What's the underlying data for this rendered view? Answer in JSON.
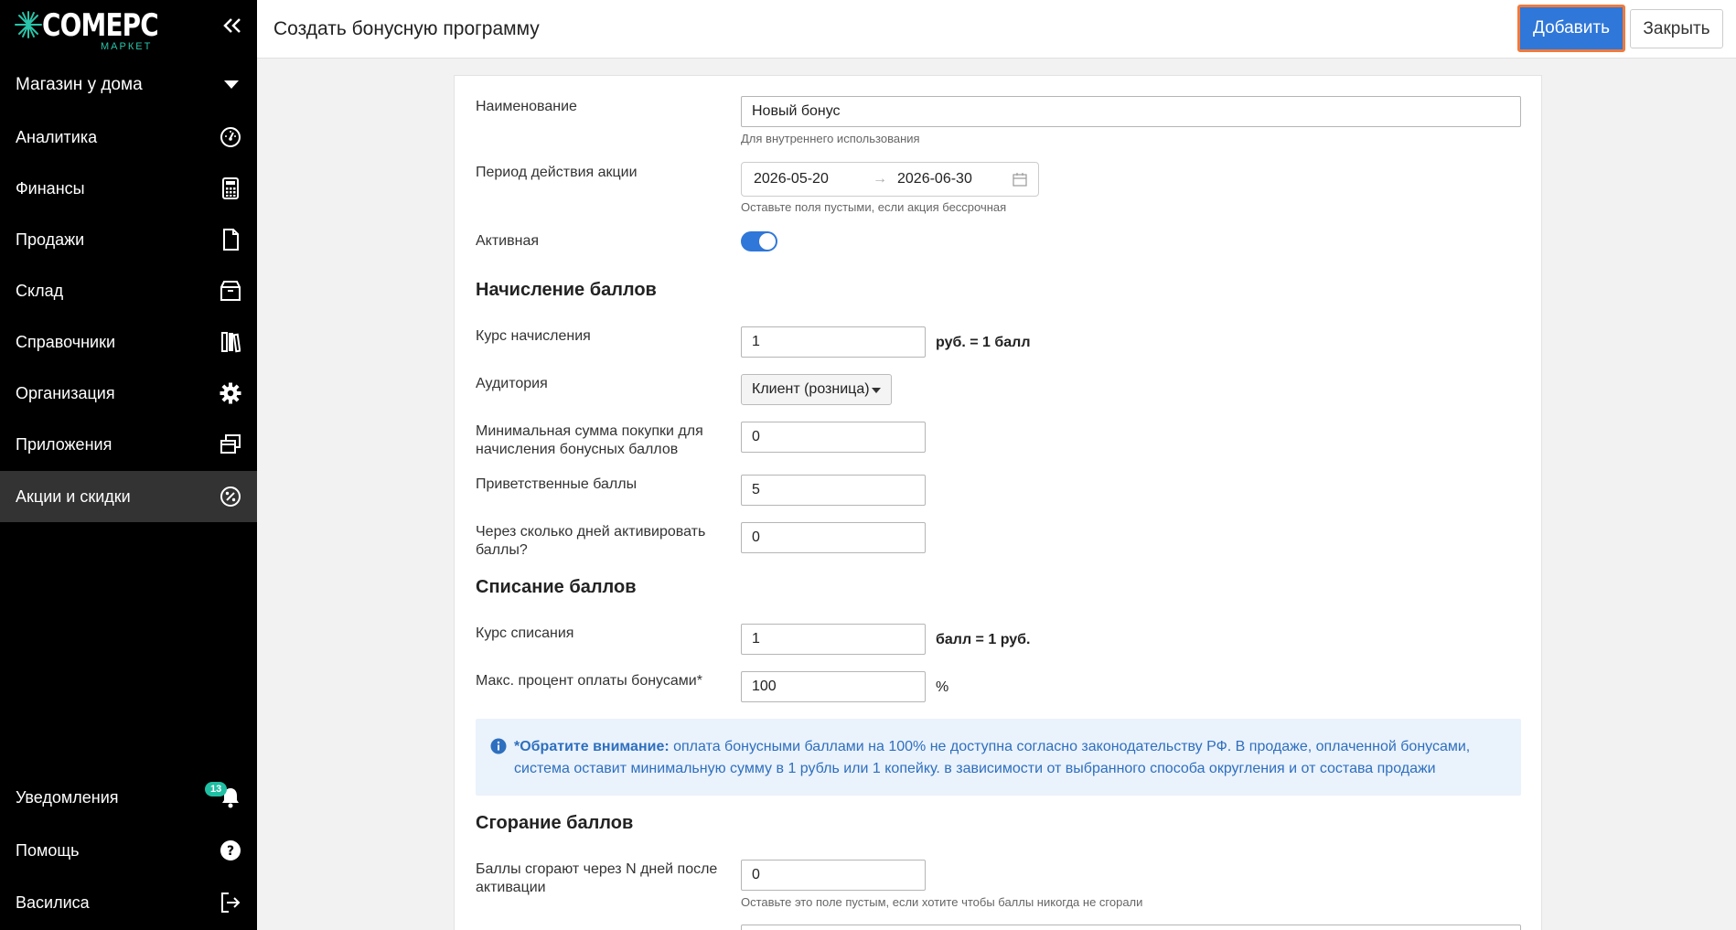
{
  "sidebar": {
    "logo": {
      "name": "COMEPC",
      "sub": "МАРКЕТ"
    },
    "store": "Магазин у дома",
    "items": [
      {
        "label": "Аналитика",
        "icon": "gauge-icon"
      },
      {
        "label": "Финансы",
        "icon": "calculator-icon"
      },
      {
        "label": "Продажи",
        "icon": "document-icon"
      },
      {
        "label": "Склад",
        "icon": "box-icon"
      },
      {
        "label": "Справочники",
        "icon": "books-icon"
      },
      {
        "label": "Организация",
        "icon": "gear-icon"
      },
      {
        "label": "Приложения",
        "icon": "windows-icon"
      },
      {
        "label": "Акции и скидки",
        "icon": "percent-icon"
      }
    ],
    "bottom": [
      {
        "label": "Уведомления",
        "icon": "bell-icon",
        "badge": "13"
      },
      {
        "label": "Помощь",
        "icon": "help-icon"
      },
      {
        "label": "Василиса",
        "icon": "logout-icon"
      }
    ]
  },
  "header": {
    "title": "Создать бонусную программу",
    "add_label": "Добавить",
    "close_label": "Закрыть"
  },
  "form": {
    "name_label": "Наименование",
    "name_value": "Новый бонус",
    "name_help": "Для внутреннего использования",
    "period_label": "Период действия акции",
    "period_start": "2026-05-20",
    "period_end": "2026-06-30",
    "period_help": "Оставьте поля пустыми, если акция бессрочная",
    "active_label": "Активная",
    "accrual_section": "Начисление баллов",
    "accrual_rate_label": "Курс начисления",
    "accrual_rate_value": "1",
    "accrual_rate_suffix": "руб. = 1 балл",
    "audience_label": "Аудитория",
    "audience_value": "Клиент (розница)",
    "min_sum_label": "Минимальная сумма покупки для начисления бонусных баллов",
    "min_sum_value": "0",
    "welcome_label": "Приветственные баллы",
    "welcome_value": "5",
    "activate_days_label": "Через сколько дней активировать баллы?",
    "activate_days_value": "0",
    "writeoff_section": "Списание баллов",
    "writeoff_rate_label": "Курс списания",
    "writeoff_rate_value": "1",
    "writeoff_rate_suffix": "балл = 1 руб.",
    "max_percent_label": "Макс. процент оплаты бонусами*",
    "max_percent_value": "100",
    "max_percent_suffix": "%",
    "notice_bold": "*Обратите внимание:",
    "notice_text": " оплата бонусными баллами на 100% не доступна согласно законодательству РФ. В продаже, оплаченной бонусами, система оставит минимальную сумму в 1 рубль или 1 копейку. в зависимости от выбранного способа округления и от состава продажи",
    "burn_section": "Сгорание баллов",
    "burn_days_label": "Баллы сгорают через N дней после активации",
    "burn_days_value": "0",
    "burn_days_help": "Оставьте это поле пустым, если хотите чтобы баллы никогда не сгорали"
  },
  "colors": {
    "accent": "#2f77d8",
    "teal": "#1fbfa3",
    "highlight": "#f07a3c"
  }
}
